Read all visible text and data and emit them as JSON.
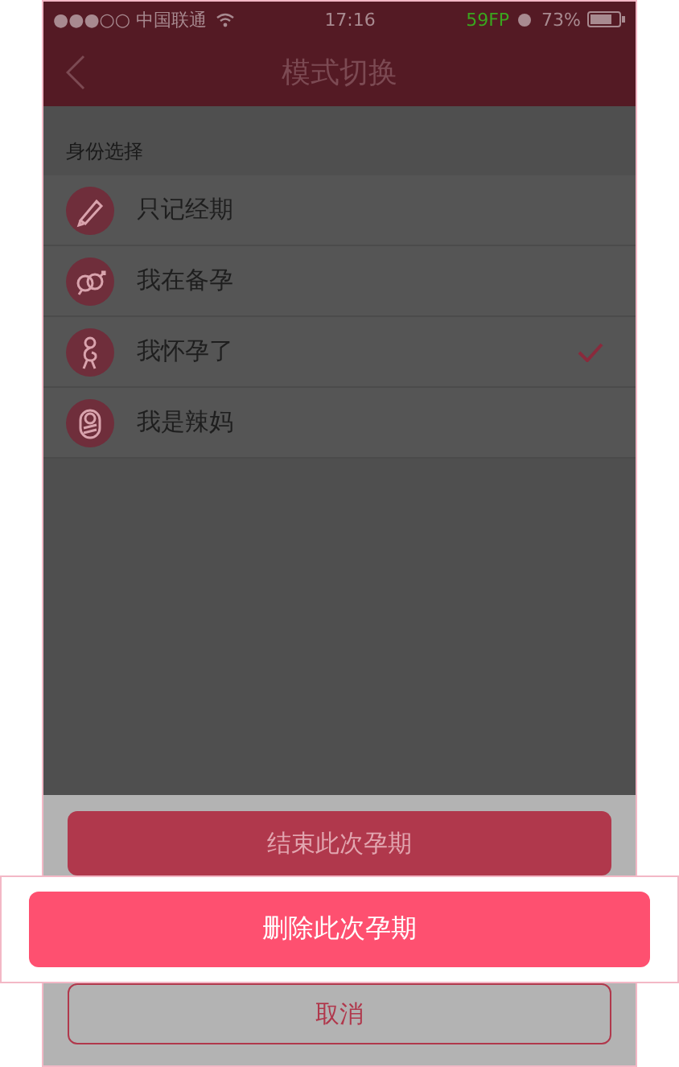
{
  "status_bar": {
    "carrier": "●●●○○ 中国联通",
    "time": "17:16",
    "fps": "59FP",
    "battery": "73%"
  },
  "nav_bar": {
    "title": "模式切换"
  },
  "section_title": "身份选择",
  "options": [
    {
      "label": "只记经期",
      "kind": "period",
      "selected": false
    },
    {
      "label": "我在备孕",
      "kind": "trying",
      "selected": false
    },
    {
      "label": "我怀孕了",
      "kind": "pregnant",
      "selected": true
    },
    {
      "label": "我是辣妈",
      "kind": "mom",
      "selected": false
    }
  ],
  "action_sheet": [
    {
      "label": "结束此次孕期",
      "kind": "secondary",
      "highlighted": false
    },
    {
      "label": "删除此次孕期",
      "kind": "primary",
      "highlighted": true
    },
    {
      "label": "取消",
      "kind": "cancel",
      "highlighted": false
    }
  ]
}
